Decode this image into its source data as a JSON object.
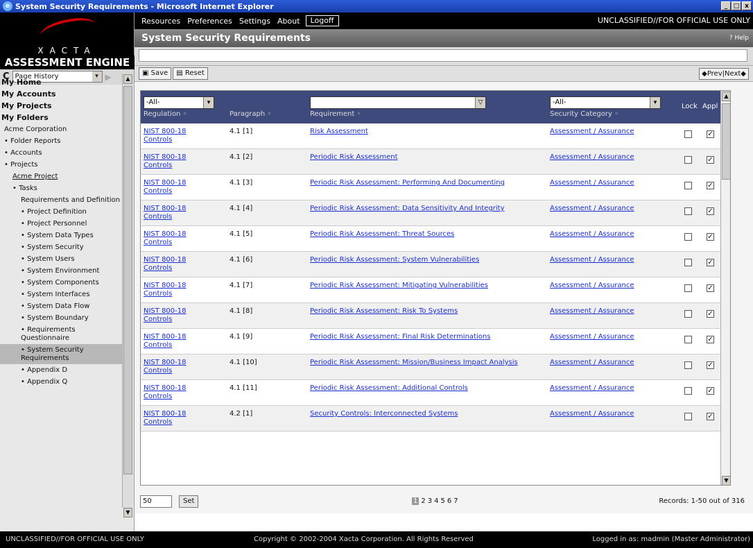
{
  "window": {
    "title": "System Security Requirements - Microsoft Internet Explorer",
    "min": "_",
    "max": "□",
    "close": "x"
  },
  "logo": {
    "brand": "XACTA",
    "product": "ASSESSMENT ENGINE"
  },
  "history": {
    "icon": "C",
    "select": "Page History"
  },
  "topnav": {
    "items": [
      "Resources",
      "Preferences",
      "Settings",
      "About"
    ],
    "logoff": "Logoff",
    "classification": "UNCLASSIFIED//FOR OFFICIAL USE ONLY"
  },
  "page": {
    "title": "System Security Requirements",
    "help": "Help"
  },
  "toolbar": {
    "save": "Save",
    "reset": "Reset",
    "prevnext": "◆Prev|Next◆"
  },
  "nav": [
    {
      "label": "My Home",
      "cls": "b"
    },
    {
      "label": "My Accounts",
      "cls": "b"
    },
    {
      "label": "My Projects",
      "cls": "b"
    },
    {
      "label": "My Folders",
      "cls": "b"
    },
    {
      "label": "Acme Corporation",
      "cls": "l1"
    },
    {
      "label": "• Folder Reports",
      "cls": "l1"
    },
    {
      "label": "• Accounts",
      "cls": "l1"
    },
    {
      "label": "• Projects",
      "cls": "l1"
    },
    {
      "label": "Acme Project",
      "cls": "l3 u"
    },
    {
      "label": "• Tasks",
      "cls": "l3"
    },
    {
      "label": "Requirements and Definition",
      "cls": "l4"
    },
    {
      "label": "• Project Definition",
      "cls": "l4"
    },
    {
      "label": "• Project Personnel",
      "cls": "l4"
    },
    {
      "label": "• System Data Types",
      "cls": "l4"
    },
    {
      "label": "• System Security",
      "cls": "l4"
    },
    {
      "label": "• System Users",
      "cls": "l4"
    },
    {
      "label": "• System Environment",
      "cls": "l4"
    },
    {
      "label": "• System Components",
      "cls": "l4"
    },
    {
      "label": "• System Interfaces",
      "cls": "l4"
    },
    {
      "label": "• System Data Flow",
      "cls": "l4"
    },
    {
      "label": "• System Boundary",
      "cls": "l4"
    },
    {
      "label": "• Requirements Questionnaire",
      "cls": "l4"
    },
    {
      "label": "• System Security Requirements",
      "cls": "l4 sel"
    },
    {
      "label": "• Appendix D",
      "cls": "l4"
    },
    {
      "label": "• Appendix Q",
      "cls": "l4"
    }
  ],
  "grid": {
    "filters": {
      "regulation": "-All-",
      "requirement": "",
      "category": "-All-"
    },
    "headers": {
      "regulation": "Regulation",
      "paragraph": "Paragraph",
      "requirement": "Requirement",
      "category": "Security Category",
      "lock": "Lock",
      "appl": "Appl"
    },
    "rows": [
      {
        "reg": "NIST 800-18 Controls",
        "par": "4.1 [1]",
        "req": "Risk Assessment",
        "cat": "Assessment / Assurance",
        "lock": false,
        "appl": true
      },
      {
        "reg": "NIST 800-18 Controls",
        "par": "4.1 [2]",
        "req": "Periodic Risk Assessment",
        "cat": "Assessment / Assurance",
        "lock": false,
        "appl": true
      },
      {
        "reg": "NIST 800-18 Controls",
        "par": "4.1 [3]",
        "req": "Periodic Risk Assessment: Performing And Documenting",
        "cat": "Assessment / Assurance",
        "lock": false,
        "appl": true
      },
      {
        "reg": "NIST 800-18 Controls",
        "par": "4.1 [4]",
        "req": "Periodic Risk Assessment: Data Sensitivity And Integrity",
        "cat": "Assessment / Assurance",
        "lock": false,
        "appl": true
      },
      {
        "reg": "NIST 800-18 Controls",
        "par": "4.1 [5]",
        "req": "Periodic Risk Assessment: Threat Sources",
        "cat": "Assessment / Assurance",
        "lock": false,
        "appl": true
      },
      {
        "reg": "NIST 800-18 Controls",
        "par": "4.1 [6]",
        "req": "Periodic Risk Assessment: System Vulnerabilities",
        "cat": "Assessment / Assurance",
        "lock": false,
        "appl": true
      },
      {
        "reg": "NIST 800-18 Controls",
        "par": "4.1 [7]",
        "req": "Periodic Risk Assessment: Mitigating Vulnerabilities",
        "cat": "Assessment / Assurance",
        "lock": false,
        "appl": true
      },
      {
        "reg": "NIST 800-18 Controls",
        "par": "4.1 [8]",
        "req": "Periodic Risk Assessment: Risk To Systems",
        "cat": "Assessment / Assurance",
        "lock": false,
        "appl": true
      },
      {
        "reg": "NIST 800-18 Controls",
        "par": "4.1 [9]",
        "req": "Periodic Risk Assessment: Final Risk Determinations",
        "cat": "Assessment / Assurance",
        "lock": false,
        "appl": true
      },
      {
        "reg": "NIST 800-18 Controls",
        "par": "4.1 [10]",
        "req": "Periodic Risk Assessment: Mission/Business Impact Analysis",
        "cat": "Assessment / Assurance",
        "lock": false,
        "appl": true
      },
      {
        "reg": "NIST 800-18 Controls",
        "par": "4.1 [11]",
        "req": "Periodic Risk Assessment: Additional Controls",
        "cat": "Assessment / Assurance",
        "lock": false,
        "appl": true
      },
      {
        "reg": "NIST 800-18 Controls",
        "par": "4.2 [1]",
        "req": "Security Controls: Interconnected Systems",
        "cat": "Assessment / Assurance",
        "lock": false,
        "appl": true
      }
    ]
  },
  "footer": {
    "pagesize": "50",
    "set": "Set",
    "pages": [
      "1",
      "2",
      "3",
      "4",
      "5",
      "6",
      "7"
    ],
    "current": "1",
    "records": "Records: 1-50 out of 316"
  },
  "status": {
    "classification": "UNCLASSIFIED//FOR OFFICIAL USE ONLY",
    "copyright": "Copyright © 2002-2004 Xacta Corporation. All Rights Reserved",
    "user": "Logged in as: madmin (Master Administrator)"
  }
}
